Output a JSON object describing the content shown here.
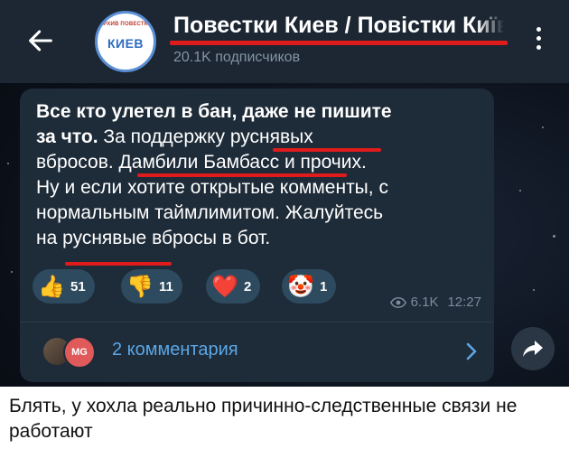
{
  "header": {
    "avatar_top_text": "АРХИВ ПОВЕСТКИ",
    "avatar_main_text": "КИЕВ",
    "title": "Повестки Киев / Повістки Київ",
    "subscribers": "20.1K подписчиков"
  },
  "message": {
    "line1_bold": "Все кто улетел в бан, даже не пишите",
    "line2_bold": "за что.",
    "line2_rest_a": " За поддержку ",
    "line2_word": "руснявых",
    "line3_a": "вбросов. ",
    "line3_word": "Дамбили Бамбасс",
    "line3_rest": " и прочих.",
    "line4": "Ну и если хотите открытые комменты, с",
    "line5": "нормальным таймлимитом. Жалуйтесь",
    "line6_a": "на ",
    "line6_word": "руснявые",
    "line6_rest": " вбросы в бот.",
    "reactions": [
      {
        "icon": "thumbs-up-icon",
        "emoji": "👍",
        "count": "51"
      },
      {
        "icon": "thumbs-down-icon",
        "emoji": "👎",
        "count": "11"
      },
      {
        "icon": "heart-icon",
        "emoji": "❤️",
        "count": "2"
      },
      {
        "icon": "clown-icon",
        "emoji": "🤡",
        "count": "1"
      }
    ],
    "views": "6.1K",
    "time": "12:27",
    "comments_avatar_initials": "MG",
    "comments_label": "2 комментария"
  },
  "caption": "Блять, у хохла реально причинно-следственные связи не работают",
  "colors": {
    "header_bg": "#1c2733",
    "bubble_bg": "#1e2b38",
    "underline_red": "#e01b1b",
    "link_blue": "#5ba7e6",
    "reaction_bg": "#2e4a5e"
  }
}
